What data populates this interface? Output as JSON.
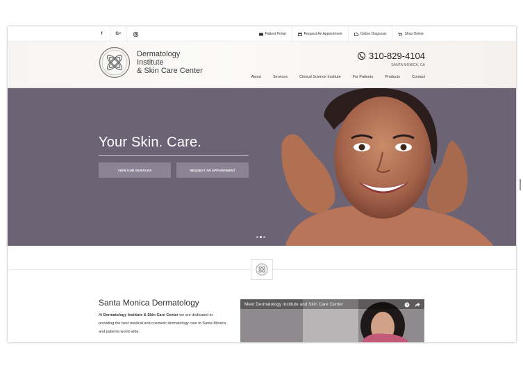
{
  "social": {
    "facebook": "f",
    "google_plus": "G+",
    "instagram_icon": "instagram-icon"
  },
  "utility_nav": [
    {
      "label": "Patient Portal",
      "icon": "portal-icon"
    },
    {
      "label": "Request An Appointment",
      "icon": "calendar-icon"
    },
    {
      "label": "Online Diagnosis",
      "icon": "diagnosis-icon"
    },
    {
      "label": "Shop Online",
      "icon": "cart-icon"
    }
  ],
  "brand": {
    "line1": "Dermatology",
    "line2": "Institute",
    "line3": "& Skin Care Center"
  },
  "contact": {
    "phone": "310-829-4104",
    "location": "SANTA MONICA, CA"
  },
  "main_nav": [
    "About",
    "Services",
    "Clinical Science Institute",
    "For Patients",
    "Products",
    "Contact"
  ],
  "hero": {
    "tagline": "Your Skin. Care.",
    "button_services": "VIEW OUR SERVICES",
    "button_appointment": "REQUEST AN APPOINTMENT",
    "slides_count": 3,
    "active_slide": 2
  },
  "intro": {
    "title": "Santa Monica Dermatology",
    "text_prefix": "At ",
    "text_bold": "Dermatology Institute & Skin Care Center",
    "text_suffix": " we are dedicated to providing the best medical and cosmetic dermatology care to Santa Monica and patients world wide."
  },
  "video": {
    "title": "Meet Dermatology Institute and Skin Care Center"
  },
  "colors": {
    "hero_bg": "#6c6375",
    "hero_button": "#8c8494",
    "text": "#333333"
  }
}
